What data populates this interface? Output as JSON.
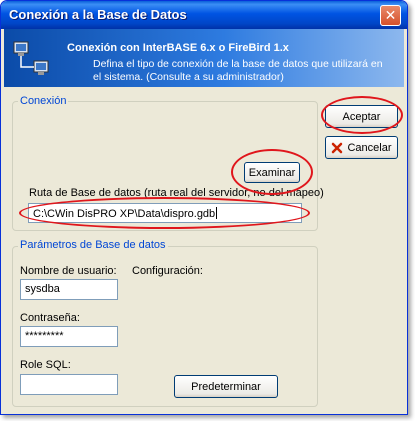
{
  "window": {
    "title": "Conexión a la Base de Datos",
    "close_label": "✕"
  },
  "header": {
    "title": "Conexión con InterBASE 6.x o FireBird 1.x",
    "description": "Defina el tipo de conexión de la base de datos que utilizará en el sistema. (Consulte a su administrador)"
  },
  "conexion": {
    "group_label": "Conexión",
    "examinar_label": "Examinar",
    "path_label": "Ruta de Base de datos (ruta real del servidor, no del mapeo)",
    "path_value": "C:\\CWin DisPRO XP\\Data\\dispro.gdb"
  },
  "buttons": {
    "aceptar": "Aceptar",
    "cancelar": "Cancelar"
  },
  "params": {
    "group_label": "Parámetros de Base de datos",
    "user_label": "Nombre de usuario:",
    "user_value": "sysdba",
    "config_label": "Configuración:",
    "password_label": "Contraseña:",
    "password_value": "*********",
    "role_label": "Role SQL:",
    "role_value": "",
    "predeterminar_label": "Predeterminar"
  },
  "colors": {
    "title_bar": "#0054e3",
    "group_label": "#0046d5",
    "highlight_ellipse": "#e0161c"
  }
}
